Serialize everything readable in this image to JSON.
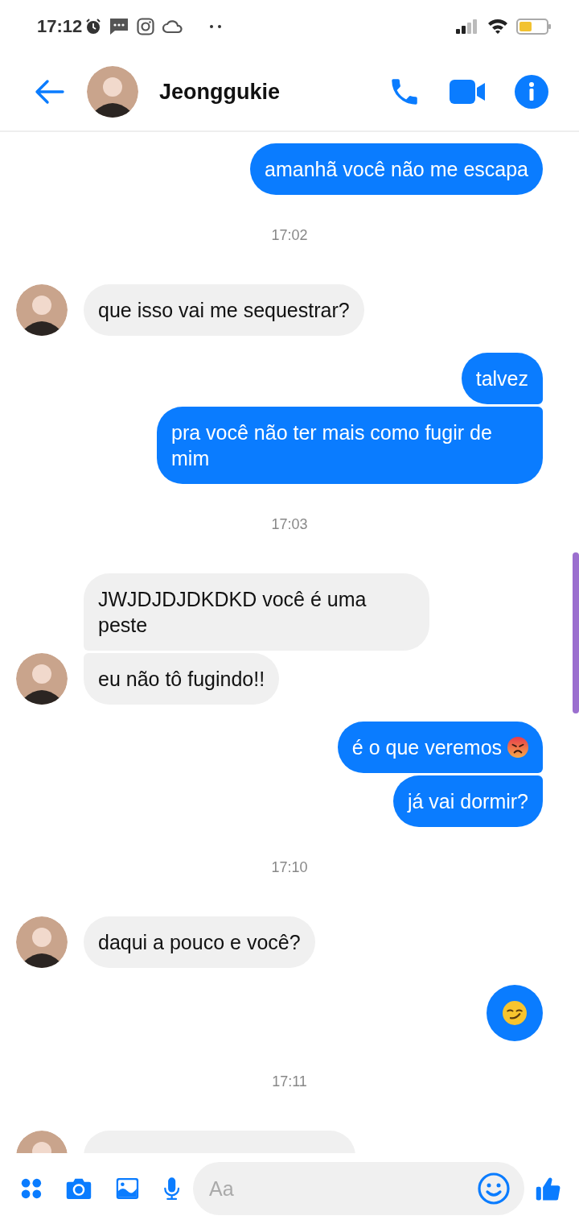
{
  "status_bar": {
    "time": "17:12"
  },
  "header": {
    "contact_name": "Jeonggukie"
  },
  "chat": [
    {
      "kind": "outgoing",
      "messages": [
        {
          "text": "amanhã você não me escapa"
        }
      ]
    },
    {
      "kind": "time",
      "text": "17:02"
    },
    {
      "kind": "incoming",
      "messages": [
        {
          "text": "que isso vai me sequestrar?"
        }
      ]
    },
    {
      "kind": "outgoing",
      "messages": [
        {
          "text": "talvez"
        },
        {
          "text": "pra você não ter mais como fugir de mim"
        }
      ]
    },
    {
      "kind": "time",
      "text": "17:03"
    },
    {
      "kind": "incoming",
      "messages": [
        {
          "text": "JWJDJDJDKDKD você é uma peste"
        },
        {
          "text": "eu não tô fugindo!!"
        }
      ]
    },
    {
      "kind": "outgoing",
      "messages": [
        {
          "kind": "text_angry",
          "text": "é o que veremos"
        },
        {
          "text": "já vai dormir?"
        }
      ]
    },
    {
      "kind": "time",
      "text": "17:10"
    },
    {
      "kind": "incoming",
      "messages": [
        {
          "text": "daqui a pouco e você?"
        }
      ]
    },
    {
      "kind": "outgoing",
      "messages": [
        {
          "kind": "smirk"
        }
      ]
    },
    {
      "kind": "time",
      "text": "17:11"
    },
    {
      "kind": "incoming",
      "messages": [
        {
          "kind": "clipped"
        }
      ]
    }
  ],
  "composer": {
    "placeholder": "Aa"
  }
}
